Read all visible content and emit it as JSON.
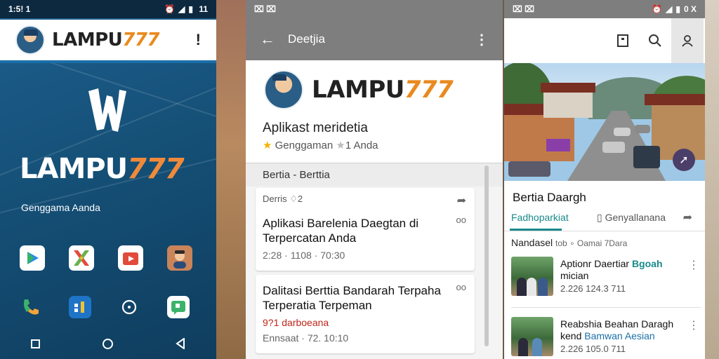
{
  "phone1": {
    "status": {
      "time": "1:5! 1",
      "right": "11"
    },
    "header": {
      "logo_main": "LAMPU",
      "logo_num": "777",
      "icon": "!"
    },
    "big_logo": {
      "main": "LAMPU",
      "num": "777"
    },
    "subtitle": "Genggama Aanda",
    "apps_row": [
      "play-store-icon",
      "crossword-icon",
      "play-box-icon",
      "profile-photo-icon"
    ],
    "dock": [
      "phone-icon",
      "sms-icon",
      "chat-icon",
      "message-icon",
      "gallery-icon"
    ]
  },
  "phone2": {
    "status": {
      "left": "⌧ ⌧"
    },
    "appbar": {
      "back": "←",
      "title": "Deetjia",
      "more": "⋮"
    },
    "logo": {
      "main": "LAMPU",
      "num": "777"
    },
    "app_name": "Aplikast meridetia",
    "rating_a": "Genggaman",
    "rating_b": "1 Anda",
    "section": "Bertia - Berttia",
    "card1": {
      "meta": "Derris ♢2",
      "title_line1": "Aplikasi Barelenia Daegtan di",
      "title_line2": "Terpercatan Anda",
      "date": "2:28 · 1108 · 70:30",
      "more": "oo"
    },
    "card2": {
      "title_line1": "Dalitasi Berttia Bandarah Terpaha",
      "title_line2": "Terperatia Terpeman",
      "red": "9?1 darboeana",
      "date": "Ennsaat · 72. 10:10",
      "more": "oo"
    }
  },
  "phone3": {
    "status": {
      "left": "⌧ ⌧",
      "right": "0 X"
    },
    "story_title": "Bertia Daargh",
    "tab1": "Fadhoparkiat",
    "tab2": "Genyallanana",
    "section": "Nandasel",
    "section_small": "tob ∘ Oamai 7Dara",
    "item1": {
      "title_a": "Aptionr Daertiar",
      "title_teal": "Bgoah",
      "title_b": "mician",
      "date": "2.226 124.3 711"
    },
    "item2": {
      "title_a": "Reabshia Beahan Daragh",
      "title_b": "kend",
      "title_blue": "Bamwan Aesian",
      "date": "2.226 105.0 711"
    }
  },
  "colors": {
    "brand_orange": "#e98a1f",
    "phone1_blue": "#155077",
    "teal": "#1a8a8c",
    "appbar_gray": "#7e7e7e"
  }
}
